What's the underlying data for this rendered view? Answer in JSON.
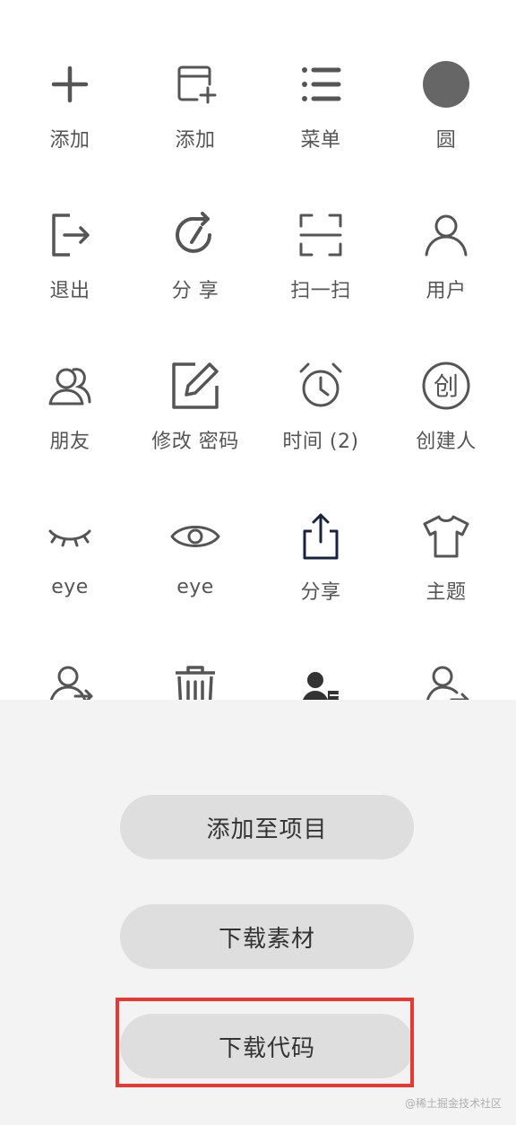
{
  "icon_grid": [
    {
      "label": "添加",
      "icon": "plus-icon"
    },
    {
      "label": "添加",
      "icon": "add-card-icon"
    },
    {
      "label": "菜单",
      "icon": "list-menu-icon"
    },
    {
      "label": "圆",
      "icon": "filled-circle-icon"
    },
    {
      "label": "退出",
      "icon": "logout-icon"
    },
    {
      "label": "分 享",
      "icon": "share-rotate-icon"
    },
    {
      "label": "扫一扫",
      "icon": "scan-icon"
    },
    {
      "label": "用户",
      "icon": "user-icon"
    },
    {
      "label": "朋友",
      "icon": "friends-icon"
    },
    {
      "label": "修改 密码",
      "icon": "edit-password-icon"
    },
    {
      "label": "时间 (2)",
      "icon": "alarm-clock-icon"
    },
    {
      "label": "创建人",
      "icon": "creator-icon"
    },
    {
      "label": "eye",
      "icon": "eye-closed-icon"
    },
    {
      "label": "eye",
      "icon": "eye-open-icon"
    },
    {
      "label": "分享",
      "icon": "share-upload-icon"
    },
    {
      "label": "主题",
      "icon": "tshirt-icon"
    },
    {
      "label": "",
      "icon": "user-transfer-icon"
    },
    {
      "label": "",
      "icon": "trash-icon"
    },
    {
      "label": "",
      "icon": "user-export-filled-icon"
    },
    {
      "label": "",
      "icon": "user-forward-icon"
    }
  ],
  "sheet": {
    "add_to_project": "添加至项目",
    "download_material": "下载素材",
    "download_code": "下载代码"
  },
  "watermark": "@稀土掘金技术社区",
  "colors": {
    "icon": "#555555",
    "sheet_bg": "#f3f3f3",
    "button_bg": "#dedede",
    "highlight": "#e53935"
  }
}
